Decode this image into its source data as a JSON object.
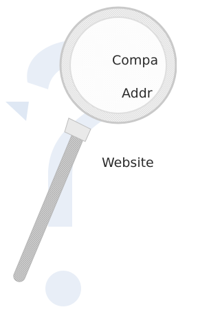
{
  "fields": {
    "company_label": "Compa",
    "address_label": "Addr",
    "website_label": "Website"
  },
  "illustration": {
    "icon": "magnifying-glass-over-question-mark",
    "question_mark_color": "#e6edf6",
    "glass_frame_color": "#c8c8c8"
  }
}
